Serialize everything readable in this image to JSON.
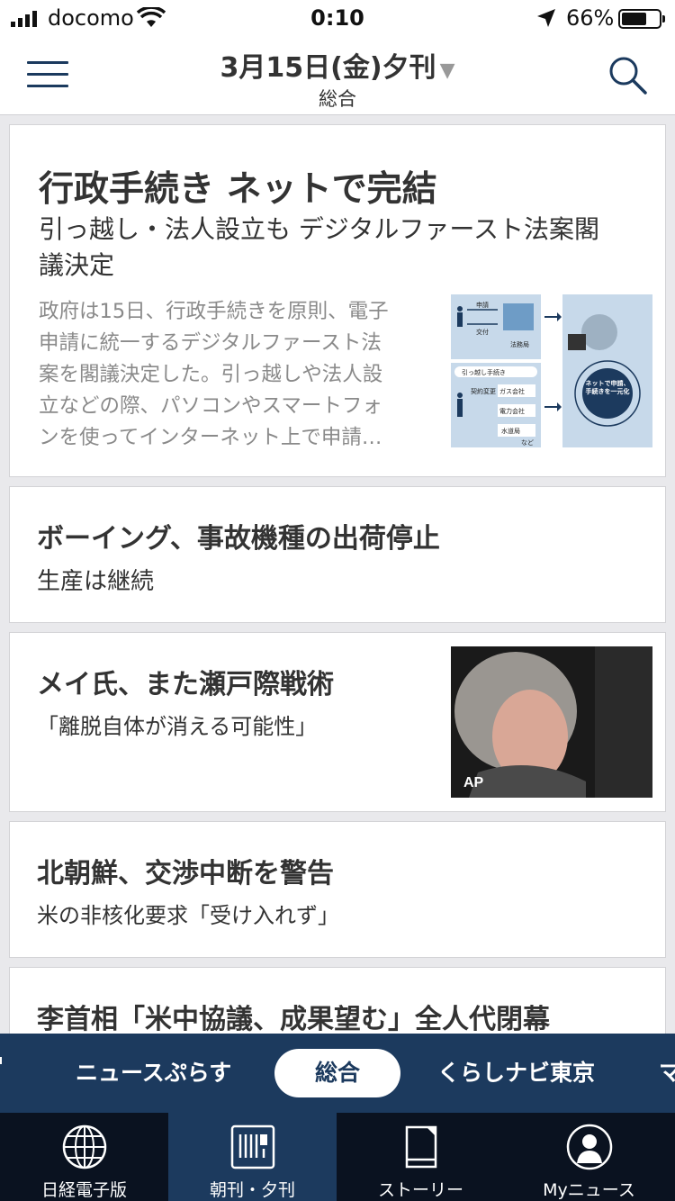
{
  "status_bar": {
    "carrier": "docomo",
    "time": "0:10",
    "battery": "66%",
    "battery_level": 0.66
  },
  "header": {
    "edition_date": "3月15日(金)夕刊",
    "section": "総合"
  },
  "articles": [
    {
      "title": "行政手続き ネットで完結",
      "subtitle_line1": "引っ越し・法人設立も デジタルファースト法案閣",
      "subtitle_line2": "議決定",
      "body_lines": [
        "政府は15日、行政手続きを原則、電子",
        "申請に統一するデジタルファースト法",
        "案を閣議決定した。引っ越しや法人設",
        "立などの際、パソコンやスマートフォ",
        "ンを使ってインターネット上で申請…"
      ],
      "graphic": {
        "labels": [
          "申請",
          "交付",
          "法務局",
          "引っ越し手続き",
          "契約変更",
          "ガス会社",
          "電力会社",
          "水道局",
          "など",
          "ネットで申請、手続きを一元化"
        ]
      }
    },
    {
      "title": "ボーイング、事故機種の出荷停止",
      "subtitle": "生産は継続"
    },
    {
      "title": "メイ氏、また瀬戸際戦術",
      "subtitle": "「離脱自体が消える可能性」",
      "photo_credit": "AP"
    },
    {
      "title": "北朝鮮、交渉中断を警告",
      "subtitle": "米の非核化要求「受け入れず」"
    },
    {
      "title": "李首相「米中協議、成果望む」全人代閉幕"
    }
  ],
  "section_tabs": [
    "ニュースぷらす",
    "総合",
    "くらしナビ東京",
    "マ"
  ],
  "active_section": "総合",
  "bottom_nav": [
    {
      "label": "日経電子版",
      "icon": "globe-icon"
    },
    {
      "label": "朝刊・夕刊",
      "icon": "newspaper-icon",
      "active": true
    },
    {
      "label": "ストーリー",
      "icon": "book-icon"
    },
    {
      "label": "Myニュース",
      "icon": "person-icon"
    }
  ],
  "colors": {
    "navy": "#1c3a5e",
    "nav_bg": "#0a1220",
    "feed_bg": "#e9e9ec",
    "body_text_gray": "#8a8a8a"
  }
}
